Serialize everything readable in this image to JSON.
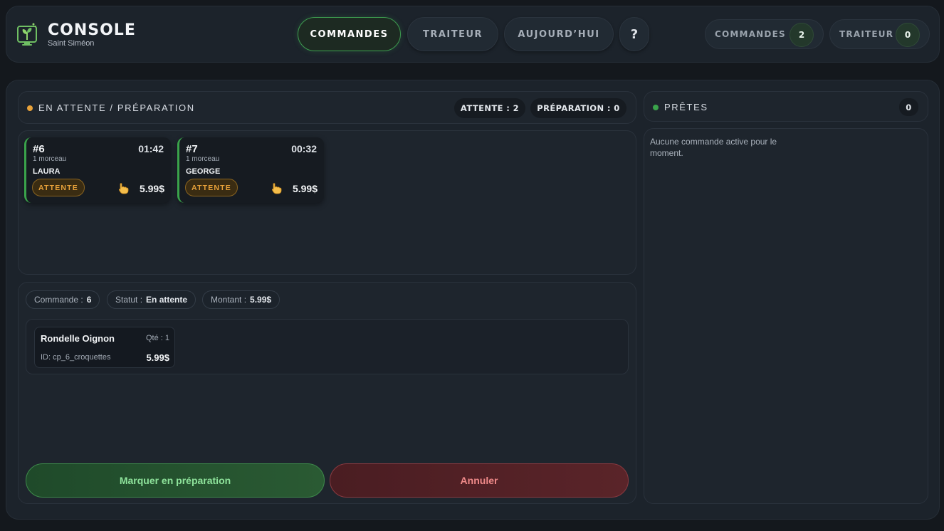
{
  "brand": {
    "title": "CONSOLE",
    "subtitle": "Saint Siméon"
  },
  "nav": {
    "tabs": [
      "COMMANDES",
      "TRAITEUR",
      "AUJOURD’HUI"
    ],
    "help": "?"
  },
  "counters": [
    {
      "label": "COMMANDES",
      "count": "2"
    },
    {
      "label": "TRAITEUR",
      "count": "0"
    }
  ],
  "pending": {
    "title": "EN ATTENTE / PRÉPARATION",
    "attente_pill": "ATTENTE : 2",
    "preparation_pill": "PRÉPARATION : 0",
    "orders": [
      {
        "number": "#6",
        "time": "01:42",
        "items": "1 morceau",
        "customer": "LAURA",
        "status": "ATTENTE",
        "price": "5.99$"
      },
      {
        "number": "#7",
        "time": "00:32",
        "items": "1 morceau",
        "customer": "GEORGE",
        "status": "ATTENTE",
        "price": "5.99$"
      }
    ]
  },
  "detail": {
    "commande_label": "Commande :",
    "commande_value": "6",
    "statut_label": "Statut :",
    "statut_value": "En attente",
    "montant_label": "Montant :",
    "montant_value": "5.99$",
    "item": {
      "name": "Rondelle Oignon",
      "qty": "Qté : 1",
      "id": "ID: cp_6_croquettes",
      "price": "5.99$"
    },
    "btn_prepare": "Marquer en préparation",
    "btn_cancel": "Annuler"
  },
  "ready": {
    "title": "PRÊTES",
    "count": "0",
    "empty_line1": "Aucune commande active pour le",
    "empty_line2": "moment."
  },
  "colors": {
    "accent_green": "#3aa34b",
    "pending_orange": "#e8a23a",
    "cancel_red": "#f08a8a",
    "background": "#14181d"
  },
  "icons": {
    "logo": "plant-monitor-icon",
    "order_hand": "pointing-hand-icon"
  }
}
